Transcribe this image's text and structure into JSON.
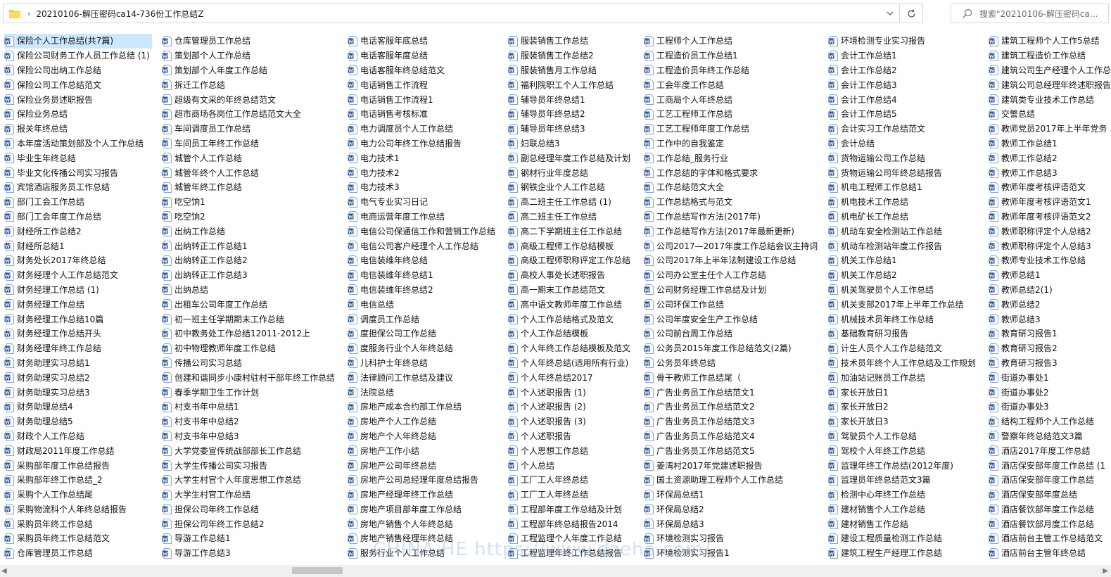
{
  "address_bar": {
    "path": "20210106-解压密码ca14-736份工作总结Z",
    "separator": "›"
  },
  "search": {
    "placeholder": "搜索\"20210106-解压密码ca..."
  },
  "watermark": "CHINA HE  https://www.dzeha.com/",
  "icon": "word-document-icon",
  "selected_item": "保险个人工作总结(共7篇)",
  "columns": [
    [
      "保险个人工作总结(共7篇)",
      "保险公司财务工作人员工作总结 (1)",
      "保险公司出纳工作总结",
      "保险公司工作总结范文",
      "保险业务员述职报告",
      "保险业务总结",
      "报关年终总结",
      "本年度活动策划部及个人工作总结",
      "毕业生年终总结",
      "毕业文化传播公司实习报告",
      "宾馆酒店服务员工作总结",
      "部门工会工作总结",
      "部门工会年度工作总结",
      "财经所工作总结2",
      "财经所总结1",
      "财务处长2017年终总结",
      "财务经理个人工作总结范文",
      "财务经理工作总结 (1)",
      "财务经理工作总结",
      "财务经理工作总结10篇",
      "财务经理工作总结开头",
      "财务经理年终工作总结",
      "财务助理实习总结1",
      "财务助理实习总结2",
      "财务助理实习总结3",
      "财务助理总结4",
      "财务助理总结5",
      "财政个人工作总结",
      "财政局2011年度工作总结",
      "采购部年度工作总结报告",
      "采购部年终工作总结_2",
      "采购个人工作总结尾",
      "采购物流科个人年终总结报告",
      "采购员年终工作总结",
      "采购员年终工作总结范文",
      "仓库管理员工作总结"
    ],
    [
      "仓库管理员工作总结",
      "策划部个人工作总结",
      "策划部个人年度工作总结",
      "拆迁工作总结",
      "超级有文采的年终总结范文",
      "超市商场各岗位工作总结范文大全",
      "车间调度员工作总结",
      "车间员工年终工作总结",
      "城管个人工作总结",
      "城管年终个人工作总结",
      "城管年终工作总结",
      "吃空饷1",
      "吃空饷2",
      "出纳工作总结",
      "出纳转正工作总结1",
      "出纳转正工作总结2",
      "出纳转正工作总结3",
      "出纳总结",
      "出租车公司年度工作总结",
      "初一班主任学期期末工作总结",
      "初中教务处工作总结12011-2012上",
      "初中物理教师年度工作总结",
      "传播公司实习总结",
      "创建和谐同步小康村驻村干部年终工作总结",
      "春季学期卫生工作计划",
      "村支书年中总结1",
      "村支书年中总结2",
      "村支书年中总结3",
      "大学党委宣传统战部部长工作总结",
      "大学生传播公司实习报告",
      "大学生村官个人年度思想工作总结",
      "大学生村官工作总结",
      "担保公司年终工作总结",
      "担保公司年终工作总结2",
      "导游工作总结1",
      "导游工作总结3"
    ],
    [
      "电话客服年底总结",
      "电话客服年度总结",
      "电话客服年终总结范文",
      "电话销售工作流程",
      "电话销售工作流程1",
      "电话销售考核标准",
      "电力调度员个人工作总结",
      "电力公司年终工作总结报告",
      "电力技术1",
      "电力技术2",
      "电力技术3",
      "电气专业实习日记",
      "电商运营年度工作总结",
      "电信公司保通信工作和营销工作总结",
      "电信公司客户经理个人工作总结",
      "电信装维年终总结",
      "电信装维年终总结1",
      "电信装维年终总结2",
      "电信总结",
      "调度员工作总结",
      "度担保公司工作总结",
      "度服务行业个人年终总结",
      "儿科护士年终总结",
      "法律顾问工作总结及建议",
      "法院总结",
      "房地产成本合约部工作总结",
      "房地产个人工作总结",
      "房地产个人年终总结",
      "房地产工作小结",
      "房地产公司年终总结",
      "房地产公司总经理年度总结报告",
      "房地产经理年终工作总结",
      "房地产项目部年度工作总结",
      "房地产销售个人年终总结",
      "房地产销售经理年终总结",
      "服务行业个人工作总结"
    ],
    [
      "服装销售工作总结",
      "服装销售工作总结2",
      "服装销售月工作总结",
      "福利院职工个人工作总结",
      "辅导员年终总结1",
      "辅导员年终总结2",
      "辅导员年终总结3",
      "妇联总结3",
      "副总经理年度工作总结及计划",
      "钢材行业年度总结",
      "钢铁企业个人工作总结",
      "高二班主任工作总结 (1)",
      "高二班主任工作总结",
      "高二下学期班主任工作总结",
      "高级工程师工作总结模板",
      "高级工程师职称评定工作总结",
      "高校人事处长述职报告",
      "高一期末工作总结范文",
      "高中语文教师年度工作总结",
      "个人工作总结格式及范文",
      "个人工作总结模板",
      "个人年终工作总结模板及范文",
      "个人年终总结(适用所有行业)",
      "个人年终总结2017",
      "个人述职报告 (1)",
      "个人述职报告 (2)",
      "个人述职报告 (3)",
      "个人述职报告",
      "个人思想工作总结",
      "个人总结",
      "工厂工人年终总结",
      "工厂工人年终总结",
      "工程部年度工作总结及计划",
      "工程部年终总结报告2014",
      "工程监理个人年度工作总结",
      "工程监理年终工作总结报告"
    ],
    [
      "工程师个人工作总结",
      "工程造价员工作总结1",
      "工程造价员年终工作总结",
      "工会年度工作总结",
      "工商局个人年终总结",
      "工艺工程师工作总结",
      "工艺工程师年度工作总结",
      "工作中的自我鉴定",
      "工作总结_服务行业",
      "工作总结的字体和格式要求",
      "工作总结范文大全",
      "工作总结格式与范文",
      "工作总结写作方法(2017年)",
      "工作总结写作方法(2017年最新更新)",
      "公司2017—2017年度工作总结会议主持词",
      "公司2017年上半年法制建设工作总结",
      "公司办公室主任个人工作总结",
      "公司财务经理工作总结及计划",
      "公司环保工作总结",
      "公司年度安全生产工作总结",
      "公司前台周工作总结",
      "公务员2015年度工作总结范文(2篇)",
      "公务员年终总结",
      "骨干教师工作总结尾（",
      "广告业务员工作总结范文1",
      "广告业务员工作总结范文2",
      "广告业务员工作总结范文3",
      "广告业务员工作总结范文4",
      "广告业务员工作总结范文5",
      "姜湾村2017年党建述职报告",
      "国土资源助理工程师个人工作总结",
      "环保局总结1",
      "环保局总结2",
      "环保局总结3",
      "环境检测实习报告",
      "环境检测实习报告1"
    ],
    [
      "环境检测专业实习报告",
      "会计工作总结1",
      "会计工作总结2",
      "会计工作总结3",
      "会计工作总结4",
      "会计工作总结5",
      "会计实习工作总结范文",
      "会计总结",
      "货物运输公司工作总结",
      "货物运输公司年终总结报告",
      "机电工程师工作总结1",
      "机电技术工作总结",
      "机电矿长工作总结",
      "机动车安全检测站工作总结",
      "机动车检测站年度工作报告",
      "机关工作总结1",
      "机关工作总结2",
      "机关驾驶员个人工作总结",
      "机关支部2017年上半年工作总结",
      "机械技术员年终工作总结",
      "基础教育研习报告",
      "计生人员个人工作总结范文",
      "技术员年终个人工作总结及工作规划",
      "加油站记账员工作总结",
      "家长开放日1",
      "家长开放日2",
      "家长开放日3",
      "驾驶员个人工作总结",
      "驾校个人年终工作总结",
      "监理年终工作总结(2012年度)",
      "监理员年终总结范文3篇",
      "检测中心年终工作总结",
      "建材销售个人工作总结",
      "建材销售工作总结",
      "建设工程质量检测工作总结",
      "建筑工程生产经理工作总结"
    ],
    [
      "建筑工程师个人工作5总结",
      "建筑工程造价工作总结",
      "建筑公司生产经理个人工作总",
      "建筑公司总经理年终述职报告",
      "建筑类专业技术工作总结",
      "交警总结",
      "教师党员2017年上半年党务",
      "教师工作总结1",
      "教师工作总结2",
      "教师工作总结3",
      "教师年度考核评语范文",
      "教师年度考核评语范文1",
      "教师年度考核评语范文2",
      "教师职称评定个人总结2",
      "教师职称评定个人总结3",
      "教师专业技术工作总结",
      "教师总结1",
      "教师总结2(1)",
      "教师总结2",
      "教师总结3",
      "教育研习报告1",
      "教育研习报告2",
      "教育研习报告3",
      "街道办事处1",
      "街道办事处2",
      "街道办事处3",
      "结构工程师个人工作总结",
      "警察年终总结范文3篇",
      "酒店2017年度工作总结",
      "酒店保安部年度工作总结 (1",
      "酒店保安部年度工作总结",
      "酒店保安部年度总结",
      "酒店餐饮部年度工作总结",
      "酒店餐饮部月度工作总结",
      "酒店前台主管工作总结范文",
      "酒店前台主管年终总结"
    ]
  ]
}
